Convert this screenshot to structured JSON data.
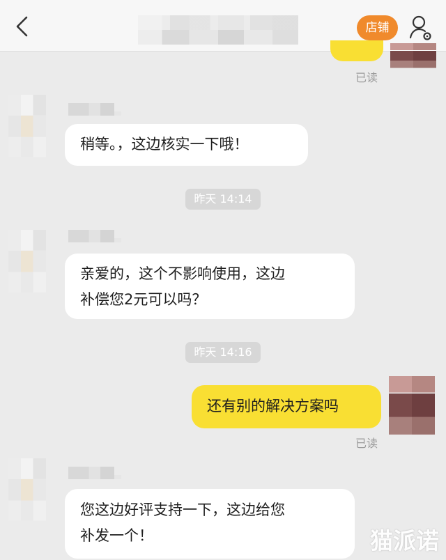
{
  "header": {
    "store_button": "店铺",
    "icons": {
      "back": "chevron-left-icon",
      "profile": "user-settings-icon"
    }
  },
  "messages": [
    {
      "side": "out",
      "text": "",
      "status": "已读"
    },
    {
      "side": "in",
      "text": "稍等。，这边核实一下哦！"
    },
    {
      "side": "time",
      "text": "昨天 14:14"
    },
    {
      "side": "in",
      "lines": [
        "亲爱的，这个不影响使用，这边",
        "补偿您2元可以吗？"
      ]
    },
    {
      "side": "time",
      "text": "昨天 14:16"
    },
    {
      "side": "out",
      "text": "还有别的解决方案吗",
      "status": "已读"
    },
    {
      "side": "in",
      "lines": [
        "您这边好评支持一下，这边给您",
        "补发一个！"
      ]
    }
  ],
  "watermark": "猫派诺",
  "colors": {
    "incoming": "#ffffff",
    "outgoing": "#f9df33",
    "store_button": "#f08a2c",
    "background": "#ebebeb"
  }
}
